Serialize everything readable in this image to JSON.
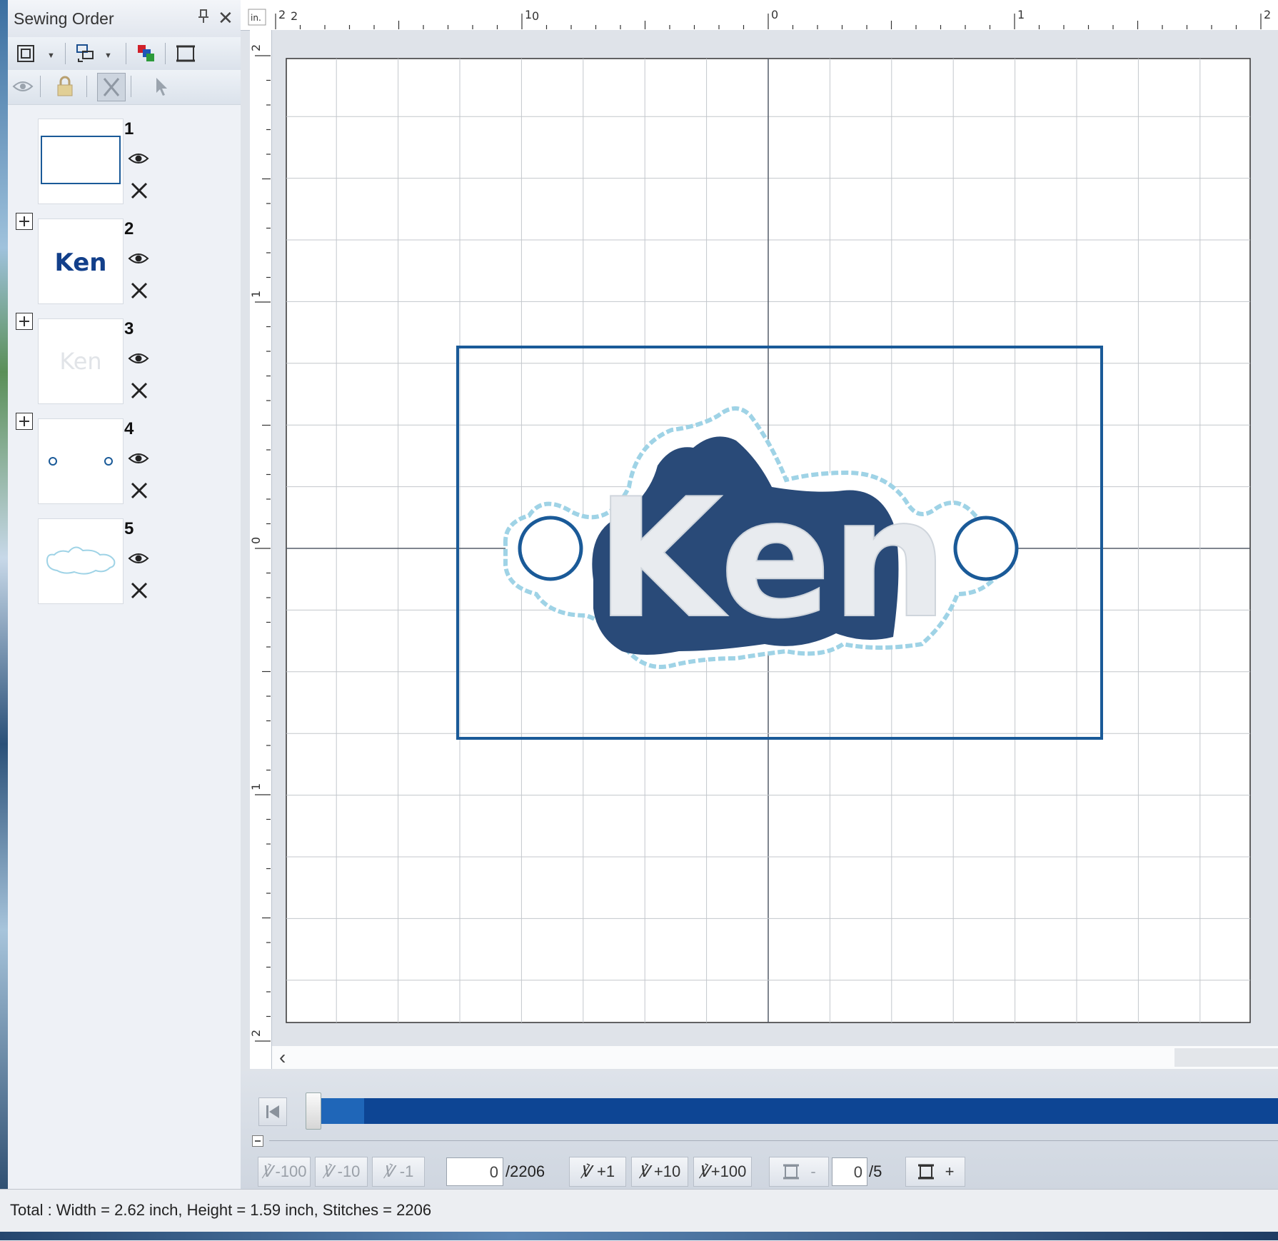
{
  "window": {
    "panel_title": "Sewing Order",
    "pin_icon": "⎕",
    "close_glyph": "✕"
  },
  "sewing_order": {
    "items": [
      {
        "number": "1",
        "thumbnail": "rectangle-frame",
        "expandable": false
      },
      {
        "number": "2",
        "thumbnail": "ken-navy-text",
        "expandable": true
      },
      {
        "number": "3",
        "thumbnail": "ken-white-text",
        "expandable": true
      },
      {
        "number": "4",
        "thumbnail": "two-circle-holes",
        "expandable": true
      },
      {
        "number": "5",
        "thumbnail": "outline-border",
        "expandable": false
      }
    ]
  },
  "ruler": {
    "unit": "in.",
    "h_labels": [
      "2",
      "1",
      "0",
      "1",
      "2"
    ],
    "v_labels": [
      "2",
      "1",
      "0",
      "1",
      "2"
    ]
  },
  "design": {
    "text": "Ken",
    "colors": {
      "navy": "#294a78",
      "white": "#e8ebef",
      "outline": "#9fd3e6",
      "frame": "#1a5a98"
    }
  },
  "simulator": {
    "back_100": "-100",
    "back_10": "-10",
    "back_1": "-1",
    "stitch_current": "0",
    "stitch_total": "/2206",
    "fwd_1": "+1",
    "fwd_10": "+10",
    "fwd_100": "+100",
    "color_prev": "-",
    "color_current": "0",
    "color_total": "/5",
    "color_next": "+"
  },
  "status_bar": {
    "text": "Total : Width = 2.62 inch, Height = 1.59 inch, Stitches = 2206"
  }
}
